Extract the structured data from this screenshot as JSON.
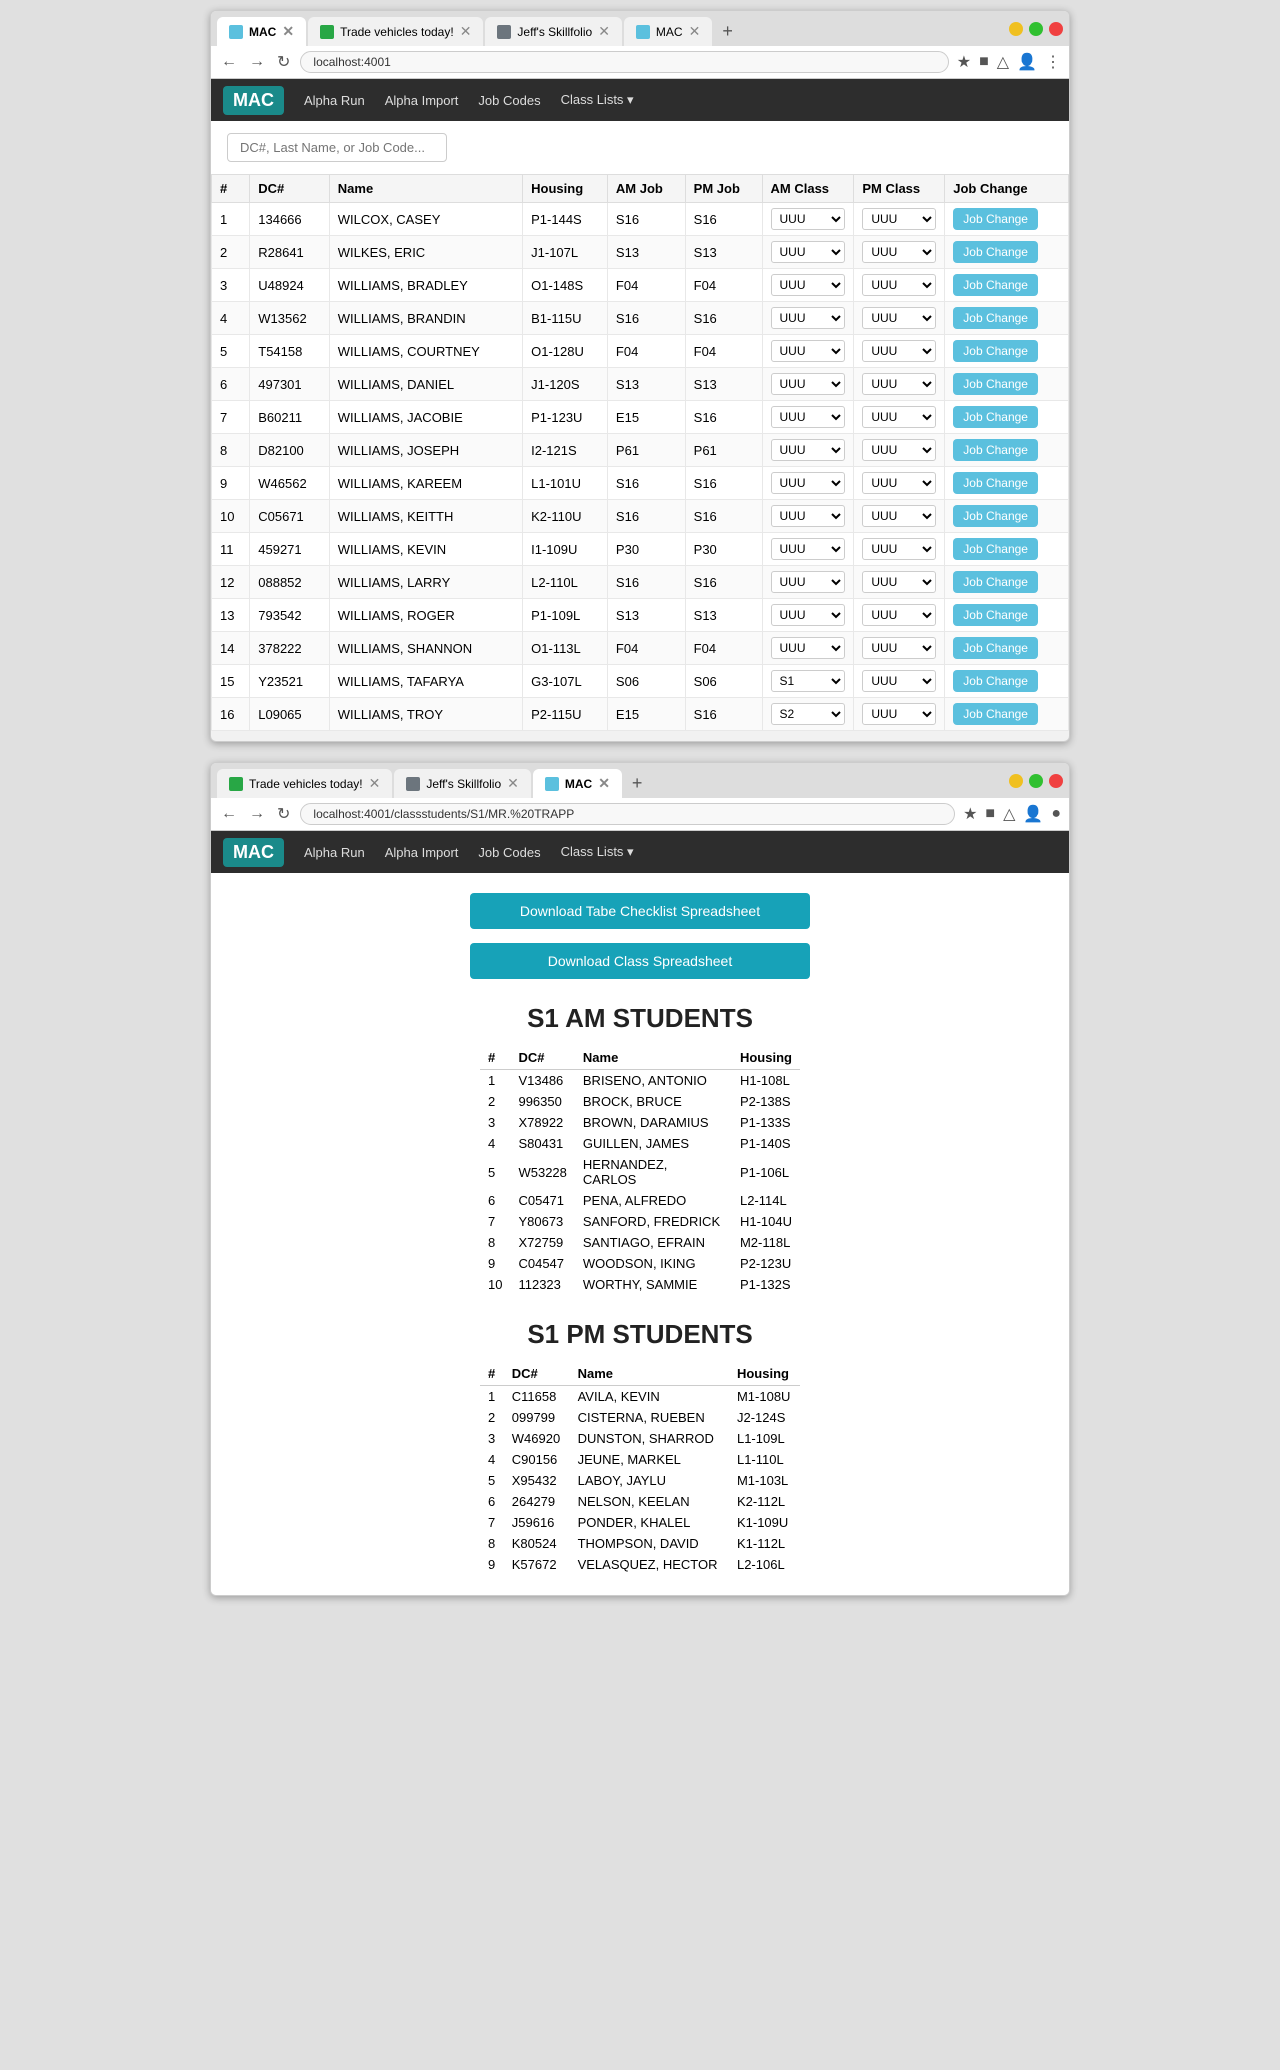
{
  "window1": {
    "tabs": [
      {
        "label": "MAC",
        "url": "localhost:4001",
        "active": true,
        "favicon_color": "#5bc0de"
      },
      {
        "label": "Trade vehicles today!",
        "url": "trade vehicles today!",
        "active": false,
        "favicon_color": "#28a745"
      },
      {
        "label": "Jeff's Skillfolio",
        "url": "jeffs skillfolio",
        "active": false,
        "favicon_color": "#6c757d"
      },
      {
        "label": "MAC",
        "url": "localhost:4001",
        "active": false,
        "favicon_color": "#5bc0de"
      }
    ],
    "url": "localhost:4001",
    "nav": {
      "brand": "MAC",
      "links": [
        "Alpha Run",
        "Alpha Import",
        "Job Codes",
        "Class Lists ▾"
      ]
    },
    "search": {
      "placeholder": "DC#, Last Name, or Job Code..."
    },
    "table": {
      "headers": [
        "#",
        "DC#",
        "Name",
        "Housing",
        "AM Job",
        "PM Job",
        "AM Class",
        "PM Class",
        "Job Change"
      ],
      "rows": [
        {
          "num": 1,
          "dc": "134666",
          "name": "WILCOX, CASEY",
          "housing": "P1-144S",
          "am_job": "S16",
          "pm_job": "S16",
          "am_class": "UUU",
          "pm_class": "UUU"
        },
        {
          "num": 2,
          "dc": "R28641",
          "name": "WILKES, ERIC",
          "housing": "J1-107L",
          "am_job": "S13",
          "pm_job": "S13",
          "am_class": "UUU",
          "pm_class": "UUU"
        },
        {
          "num": 3,
          "dc": "U48924",
          "name": "WILLIAMS, BRADLEY",
          "housing": "O1-148S",
          "am_job": "F04",
          "pm_job": "F04",
          "am_class": "UUU",
          "pm_class": "UUU"
        },
        {
          "num": 4,
          "dc": "W13562",
          "name": "WILLIAMS, BRANDIN",
          "housing": "B1-115U",
          "am_job": "S16",
          "pm_job": "S16",
          "am_class": "UUU",
          "pm_class": "UUU"
        },
        {
          "num": 5,
          "dc": "T54158",
          "name": "WILLIAMS, COURTNEY",
          "housing": "O1-128U",
          "am_job": "F04",
          "pm_job": "F04",
          "am_class": "UUU",
          "pm_class": "UUU"
        },
        {
          "num": 6,
          "dc": "497301",
          "name": "WILLIAMS, DANIEL",
          "housing": "J1-120S",
          "am_job": "S13",
          "pm_job": "S13",
          "am_class": "UUU",
          "pm_class": "UUU"
        },
        {
          "num": 7,
          "dc": "B60211",
          "name": "WILLIAMS, JACOBIE",
          "housing": "P1-123U",
          "am_job": "E15",
          "pm_job": "S16",
          "am_class": "UUU",
          "pm_class": "UUU"
        },
        {
          "num": 8,
          "dc": "D82100",
          "name": "WILLIAMS, JOSEPH",
          "housing": "I2-121S",
          "am_job": "P61",
          "pm_job": "P61",
          "am_class": "UUU",
          "pm_class": "UUU"
        },
        {
          "num": 9,
          "dc": "W46562",
          "name": "WILLIAMS, KAREEM",
          "housing": "L1-101U",
          "am_job": "S16",
          "pm_job": "S16",
          "am_class": "UUU",
          "pm_class": "UUU"
        },
        {
          "num": 10,
          "dc": "C05671",
          "name": "WILLIAMS, KEITTH",
          "housing": "K2-110U",
          "am_job": "S16",
          "pm_job": "S16",
          "am_class": "UUU",
          "pm_class": "UUU"
        },
        {
          "num": 11,
          "dc": "459271",
          "name": "WILLIAMS, KEVIN",
          "housing": "I1-109U",
          "am_job": "P30",
          "pm_job": "P30",
          "am_class": "UUU",
          "pm_class": "UUU"
        },
        {
          "num": 12,
          "dc": "088852",
          "name": "WILLIAMS, LARRY",
          "housing": "L2-110L",
          "am_job": "S16",
          "pm_job": "S16",
          "am_class": "UUU",
          "pm_class": "UUU"
        },
        {
          "num": 13,
          "dc": "793542",
          "name": "WILLIAMS, ROGER",
          "housing": "P1-109L",
          "am_job": "S13",
          "pm_job": "S13",
          "am_class": "UUU",
          "pm_class": "UUU"
        },
        {
          "num": 14,
          "dc": "378222",
          "name": "WILLIAMS, SHANNON",
          "housing": "O1-113L",
          "am_job": "F04",
          "pm_job": "F04",
          "am_class": "UUU",
          "pm_class": "UUU"
        },
        {
          "num": 15,
          "dc": "Y23521",
          "name": "WILLIAMS, TAFARYA",
          "housing": "G3-107L",
          "am_job": "S06",
          "pm_job": "S06",
          "am_class": "S1",
          "pm_class": "UUU"
        },
        {
          "num": 16,
          "dc": "L09065",
          "name": "WILLIAMS, TROY",
          "housing": "P2-115U",
          "am_job": "E15",
          "pm_job": "S16",
          "am_class": "S2",
          "pm_class": "UUU"
        }
      ],
      "job_change_label": "Job Change"
    }
  },
  "window2": {
    "tabs": [
      {
        "label": "Trade vehicles today!",
        "active": false,
        "favicon_color": "#28a745"
      },
      {
        "label": "Jeff's Skillfolio",
        "active": false,
        "favicon_color": "#6c757d"
      },
      {
        "label": "MAC",
        "active": true,
        "favicon_color": "#5bc0de"
      }
    ],
    "url": "localhost:4001/classstudents/S1/MR.%20TRAPP",
    "nav": {
      "brand": "MAC",
      "links": [
        "Alpha Run",
        "Alpha Import",
        "Job Codes",
        "Class Lists ▾"
      ]
    },
    "page": {
      "download_tabe_btn": "Download Tabe Checklist Spreadsheet",
      "download_class_btn": "Download Class Spreadsheet",
      "am_section_title": "S1 AM STUDENTS",
      "pm_section_title": "S1 PM STUDENTS",
      "am_headers": [
        "#",
        "DC#",
        "Name",
        "Housing"
      ],
      "am_students": [
        {
          "num": 1,
          "dc": "V13486",
          "name": "BRISENO, ANTONIO",
          "housing": "H1-108L"
        },
        {
          "num": 2,
          "dc": "996350",
          "name": "BROCK, BRUCE",
          "housing": "P2-138S"
        },
        {
          "num": 3,
          "dc": "X78922",
          "name": "BROWN, DARAMIUS",
          "housing": "P1-133S"
        },
        {
          "num": 4,
          "dc": "S80431",
          "name": "GUILLEN, JAMES",
          "housing": "P1-140S"
        },
        {
          "num": 5,
          "dc": "W53228",
          "name": "HERNANDEZ, CARLOS",
          "housing": "P1-106L"
        },
        {
          "num": 6,
          "dc": "C05471",
          "name": "PENA, ALFREDO",
          "housing": "L2-114L"
        },
        {
          "num": 7,
          "dc": "Y80673",
          "name": "SANFORD, FREDRICK",
          "housing": "H1-104U"
        },
        {
          "num": 8,
          "dc": "X72759",
          "name": "SANTIAGO, EFRAIN",
          "housing": "M2-118L"
        },
        {
          "num": 9,
          "dc": "C04547",
          "name": "WOODSON, IKING",
          "housing": "P2-123U"
        },
        {
          "num": 10,
          "dc": "112323",
          "name": "WORTHY, SAMMIE",
          "housing": "P1-132S"
        }
      ],
      "pm_headers": [
        "#",
        "DC#",
        "Name",
        "Housing"
      ],
      "pm_students": [
        {
          "num": 1,
          "dc": "C11658",
          "name": "AVILA, KEVIN",
          "housing": "M1-108U"
        },
        {
          "num": 2,
          "dc": "099799",
          "name": "CISTERNA, RUEBEN",
          "housing": "J2-124S"
        },
        {
          "num": 3,
          "dc": "W46920",
          "name": "DUNSTON, SHARROD",
          "housing": "L1-109L"
        },
        {
          "num": 4,
          "dc": "C90156",
          "name": "JEUNE, MARKEL",
          "housing": "L1-110L"
        },
        {
          "num": 5,
          "dc": "X95432",
          "name": "LABOY, JAYLU",
          "housing": "M1-103L"
        },
        {
          "num": 6,
          "dc": "264279",
          "name": "NELSON, KEELAN",
          "housing": "K2-112L"
        },
        {
          "num": 7,
          "dc": "J59616",
          "name": "PONDER, KHALEL",
          "housing": "K1-109U"
        },
        {
          "num": 8,
          "dc": "K80524",
          "name": "THOMPSON, DAVID",
          "housing": "K1-112L"
        },
        {
          "num": 9,
          "dc": "K57672",
          "name": "VELASQUEZ, HECTOR",
          "housing": "L2-106L"
        }
      ]
    }
  }
}
